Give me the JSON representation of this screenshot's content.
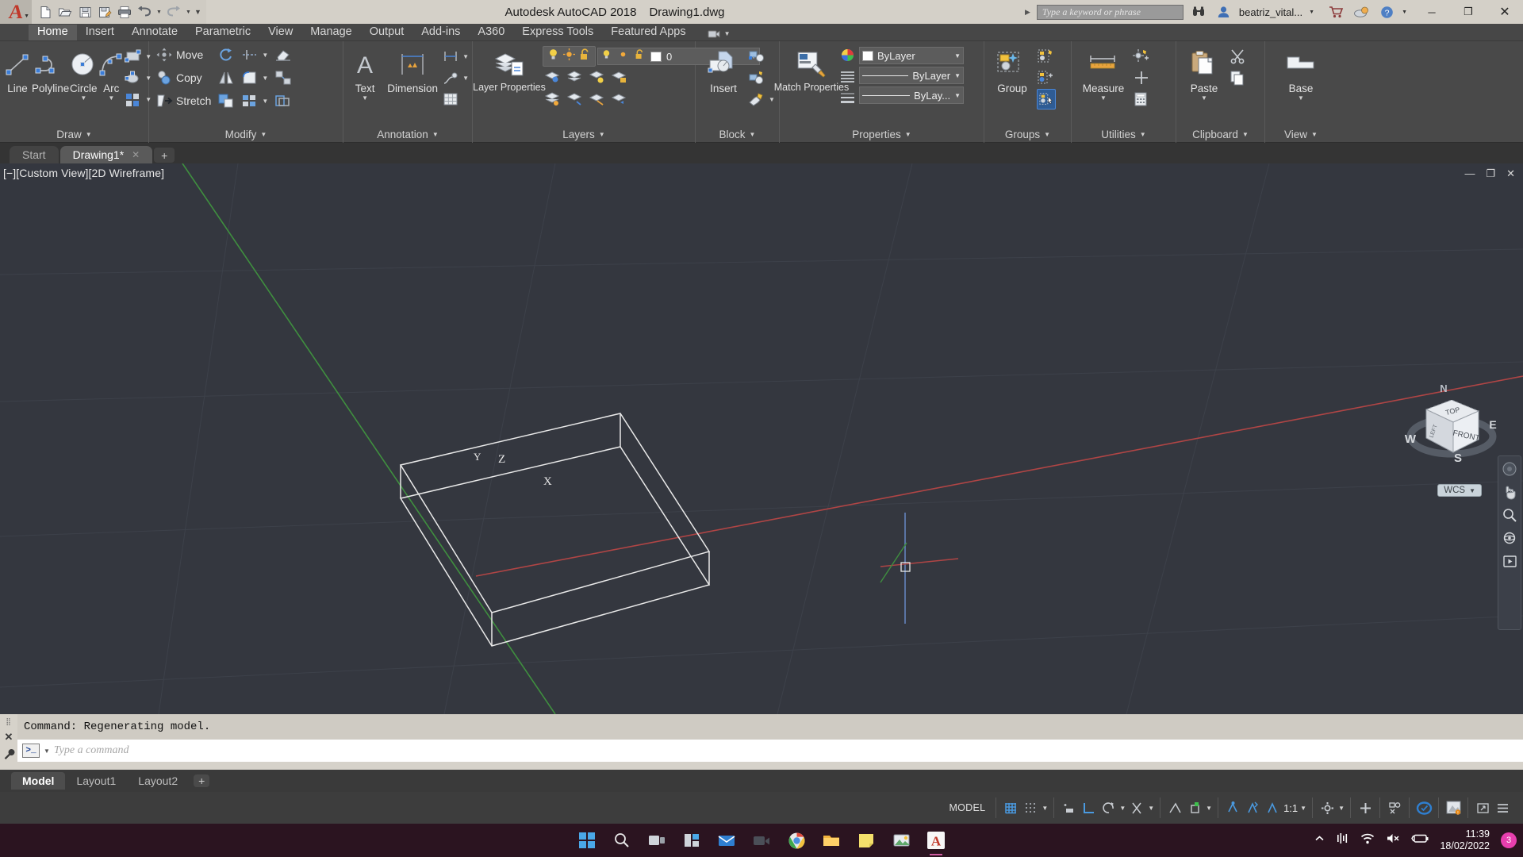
{
  "titlebar": {
    "app_name": "Autodesk AutoCAD 2018",
    "document": "Drawing1.dwg",
    "user": "beatriz_vital...",
    "search_placeholder": "Type a keyword or phrase",
    "quick_access": [
      {
        "name": "new-file",
        "glyph": "new"
      },
      {
        "name": "open-file",
        "glyph": "open"
      },
      {
        "name": "save-file",
        "glyph": "save"
      },
      {
        "name": "save-as",
        "glyph": "saveas"
      },
      {
        "name": "plot",
        "glyph": "print"
      },
      {
        "name": "undo",
        "glyph": "undo"
      },
      {
        "name": "redo",
        "glyph": "redo"
      }
    ],
    "window_buttons": {
      "minimize": "─",
      "maximize": "❐",
      "close": "✕"
    }
  },
  "ribbon_tabs": [
    {
      "label": "Home",
      "active": true
    },
    {
      "label": "Insert",
      "active": false
    },
    {
      "label": "Annotate",
      "active": false
    },
    {
      "label": "Parametric",
      "active": false
    },
    {
      "label": "View",
      "active": false
    },
    {
      "label": "Manage",
      "active": false
    },
    {
      "label": "Output",
      "active": false
    },
    {
      "label": "Add-ins",
      "active": false
    },
    {
      "label": "A360",
      "active": false
    },
    {
      "label": "Express Tools",
      "active": false
    },
    {
      "label": "Featured Apps",
      "active": false
    }
  ],
  "panels": {
    "draw": {
      "label": "Draw",
      "buttons": [
        {
          "label": "Line",
          "icon": "line-icon",
          "dropdown": false
        },
        {
          "label": "Polyline",
          "icon": "polyline-icon",
          "dropdown": false
        },
        {
          "label": "Circle",
          "icon": "circle-icon",
          "dropdown": true
        },
        {
          "label": "Arc",
          "icon": "arc-icon",
          "dropdown": true
        }
      ],
      "small_buttons": [
        {
          "icon": "rectangle-icon",
          "dropdown": true
        },
        {
          "icon": "ellipse-icon",
          "dropdown": true
        },
        {
          "icon": "hatch-icon",
          "dropdown": true
        }
      ]
    },
    "modify": {
      "label": "Modify",
      "rows": [
        {
          "label": "Move",
          "icon": "move-icon"
        },
        {
          "label": "Copy",
          "icon": "copy-icon"
        },
        {
          "label": "Stretch",
          "icon": "stretch-icon"
        }
      ],
      "small_buttons": [
        {
          "icon": "rotate-icon",
          "dropdown": true
        },
        {
          "icon": "mirror-icon",
          "dropdown": true
        },
        {
          "icon": "scale-icon",
          "dropdown": true
        },
        {
          "icon": "trim-icon",
          "dropdown": true
        },
        {
          "icon": "fillet-icon",
          "dropdown": true
        },
        {
          "icon": "array-icon",
          "dropdown": true
        },
        {
          "icon": "erase-icon",
          "dropdown": false
        },
        {
          "icon": "explode-icon",
          "dropdown": false
        },
        {
          "icon": "offset-icon",
          "dropdown": false
        }
      ]
    },
    "annotation": {
      "label": "Annotation",
      "buttons": [
        {
          "label": "Text",
          "icon": "text-icon",
          "dropdown": true
        },
        {
          "label": "Dimension",
          "icon": "dimension-icon",
          "dropdown": false
        }
      ],
      "small_buttons": [
        {
          "icon": "dimension-linear-icon",
          "dropdown": true
        },
        {
          "icon": "leader-icon",
          "dropdown": true
        },
        {
          "icon": "table-icon",
          "dropdown": false
        }
      ]
    },
    "layers": {
      "label": "Layers",
      "main_button": {
        "label": "Layer Properties",
        "icon": "layer-properties-icon"
      },
      "layer_dropdown_value": "0",
      "state_icons": [
        "lightbulb-icon",
        "sun-icon",
        "unlock-icon"
      ],
      "small_buttons": [
        {
          "icon": "layer-isolate-icon"
        },
        {
          "icon": "layer-freeze-icon"
        },
        {
          "icon": "layer-off-icon"
        },
        {
          "icon": "layer-lock-icon"
        },
        {
          "icon": "layer-unisolate-icon"
        },
        {
          "icon": "layer-make-current-icon"
        },
        {
          "icon": "layer-match-icon"
        },
        {
          "icon": "layer-previous-icon"
        }
      ]
    },
    "block": {
      "label": "Block",
      "main_button": {
        "label": "Insert",
        "icon": "insert-block-icon",
        "dropdown": false
      },
      "small_buttons": [
        {
          "icon": "create-block-icon"
        },
        {
          "icon": "edit-block-icon"
        },
        {
          "icon": "edit-attribute-icon",
          "dropdown": true
        }
      ]
    },
    "properties": {
      "label": "Properties",
      "main_button": {
        "label": "Match Properties",
        "icon": "match-properties-icon"
      },
      "color": {
        "value": "ByLayer",
        "swatch": "#ffffff",
        "icon": "color-wheel-icon"
      },
      "linetype": {
        "value": "ByLayer",
        "icon": "linetype-icon"
      },
      "lineweight": {
        "value": "ByLay...",
        "icon": "lineweight-icon"
      },
      "list_icons": [
        "list-icon",
        "transparency-icon"
      ]
    },
    "groups": {
      "label": "Groups",
      "main_button": {
        "label": "Group",
        "icon": "group-icon"
      },
      "small_buttons": [
        {
          "icon": "ungroup-icon"
        },
        {
          "icon": "group-edit-icon"
        },
        {
          "icon": "group-selection-on-icon",
          "active": true
        }
      ]
    },
    "utilities": {
      "label": "Utilities",
      "main_button": {
        "label": "Measure",
        "icon": "measure-icon",
        "dropdown": true
      },
      "small_buttons": [
        {
          "icon": "quick-select-icon"
        },
        {
          "icon": "point-icon"
        },
        {
          "icon": "calculator-icon"
        }
      ]
    },
    "clipboard": {
      "label": "Clipboard",
      "main_button": {
        "label": "Paste",
        "icon": "paste-icon",
        "dropdown": true
      },
      "small_buttons": [
        {
          "icon": "cut-icon"
        },
        {
          "icon": "copy-clip-icon"
        }
      ]
    },
    "view": {
      "label": "View",
      "main_button": {
        "label": "Base",
        "icon": "base-view-icon",
        "dropdown": true
      }
    }
  },
  "file_tabs": [
    {
      "label": "Start",
      "active": false,
      "closable": false
    },
    {
      "label": "Drawing1*",
      "active": true,
      "closable": true
    }
  ],
  "file_tab_add": "+",
  "viewport": {
    "label": "[−][Custom View][2D Wireframe]",
    "controls": [
      "—",
      "❐",
      "✕"
    ],
    "viewcube": {
      "top_face": "TOP",
      "front_face": "FRONT",
      "left_face": "LEFT",
      "compass": {
        "north": "N",
        "south": "S",
        "east": "E",
        "west": "W"
      }
    },
    "wcs_label": "WCS",
    "ucs_axes": {
      "x": "X",
      "y": "Y",
      "z": "Z"
    }
  },
  "command_line": {
    "history": "Command:   Regenerating model.",
    "prompt_glyph": ">_",
    "placeholder": "Type a command"
  },
  "layout_tabs": [
    {
      "label": "Model",
      "active": true
    },
    {
      "label": "Layout1",
      "active": false
    },
    {
      "label": "Layout2",
      "active": false
    }
  ],
  "layout_tab_add": "+",
  "status_bar": {
    "space": "MODEL",
    "scale": "1:1",
    "items": [
      {
        "name": "grid-display-icon",
        "active": true
      },
      {
        "name": "snap-mode-icon",
        "active": false
      },
      {
        "name": "infer-constraints-icon",
        "active": false
      },
      {
        "name": "ortho-mode-icon",
        "active": true
      },
      {
        "name": "polar-tracking-icon",
        "active": false
      },
      {
        "name": "object-snap-tracking-icon",
        "active": false
      },
      {
        "name": "object-snap-icon",
        "active": false
      },
      {
        "name": "lineweight-icon",
        "active": false
      },
      {
        "name": "transparency-icon",
        "active": false
      },
      {
        "name": "selection-cycling-icon",
        "active": true
      },
      {
        "name": "3d-object-snap-icon",
        "active": false
      },
      {
        "name": "dynamic-ucs-icon",
        "active": false
      },
      {
        "name": "annotation-visibility-icon",
        "active": false
      },
      {
        "name": "workspace-switching-icon",
        "active": false
      },
      {
        "name": "hardware-acceleration-icon",
        "active": true
      },
      {
        "name": "isolate-objects-icon",
        "active": false
      },
      {
        "name": "clean-screen-icon",
        "active": false
      },
      {
        "name": "customization-icon",
        "active": false
      }
    ]
  },
  "taskbar": {
    "apps": [
      {
        "name": "start-button-icon"
      },
      {
        "name": "search-icon"
      },
      {
        "name": "task-view-icon"
      },
      {
        "name": "widgets-icon"
      },
      {
        "name": "mail-icon"
      },
      {
        "name": "video-icon"
      },
      {
        "name": "chrome-icon"
      },
      {
        "name": "file-explorer-icon"
      },
      {
        "name": "notes-icon"
      },
      {
        "name": "photos-icon"
      },
      {
        "name": "autocad-icon",
        "active": true
      }
    ],
    "tray": {
      "time": "11:39",
      "date": "18/02/2022",
      "badge_count": "3",
      "icons": [
        "show-hidden-icons",
        "network-usage-icon",
        "wifi-icon",
        "volume-muted-icon",
        "battery-charging-icon"
      ]
    }
  },
  "colors": {
    "canvas_bg": "#34373f",
    "ribbon_bg": "#494949",
    "titlebar_bg": "#d4d0c8",
    "accent_blue": "#3b8fd4",
    "axis_x_red": "#b04545",
    "axis_y_green": "#3f8f3f",
    "taskbar_bg": "#2b1420",
    "badge_pink": "#e83fae"
  }
}
